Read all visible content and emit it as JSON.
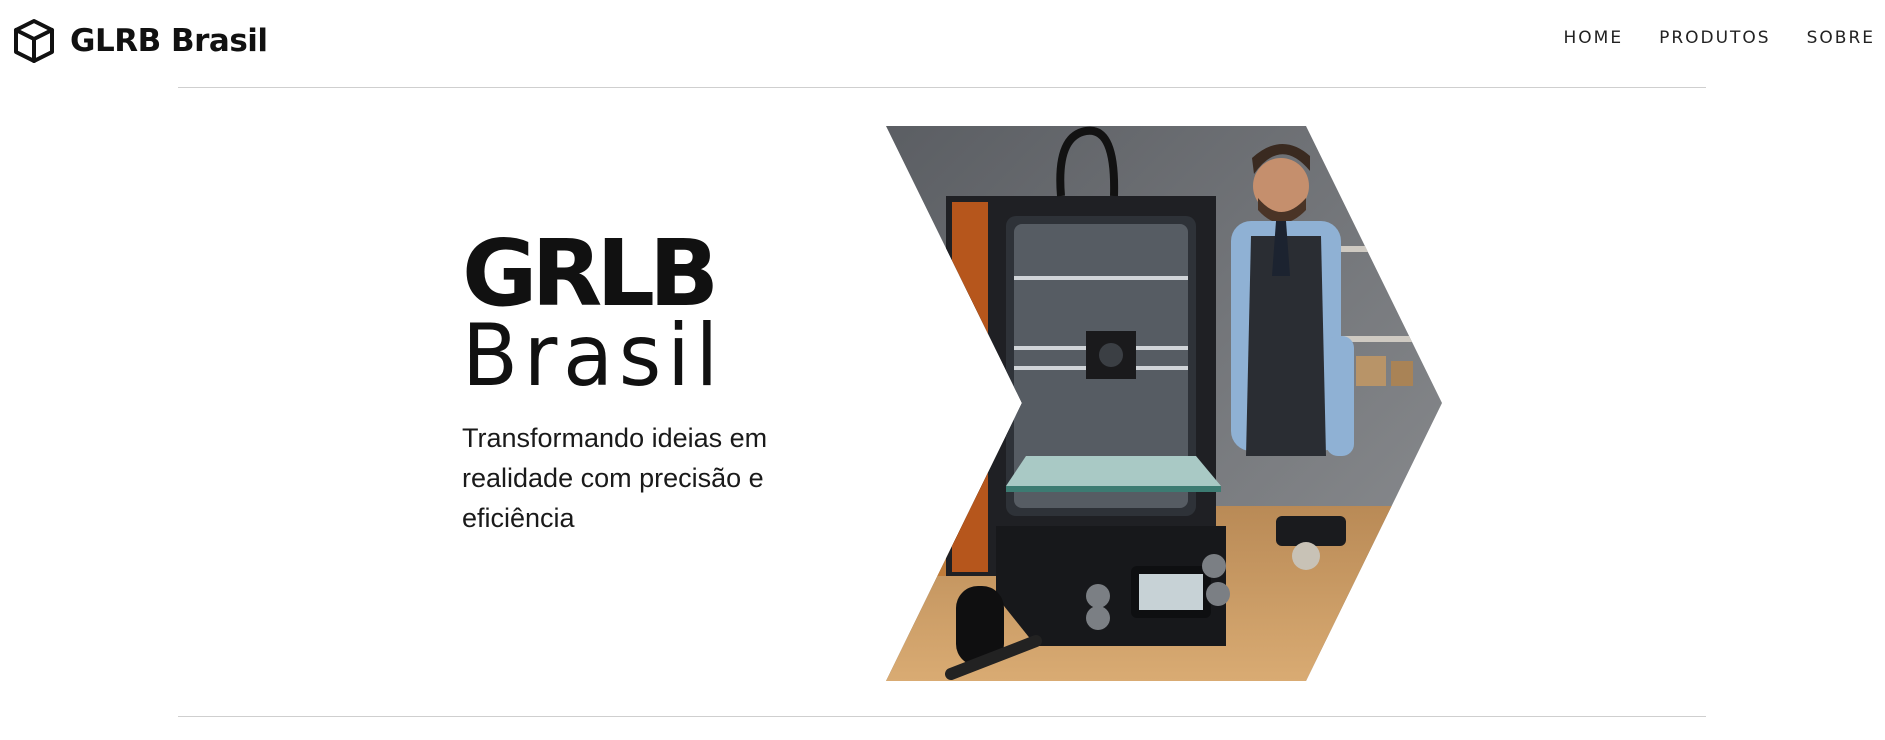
{
  "header": {
    "logo_icon": "cube-icon",
    "brand_name": "GLRB Brasil",
    "nav": [
      {
        "label": "HOME"
      },
      {
        "label": "PRODUTOS"
      },
      {
        "label": "SOBRE"
      }
    ]
  },
  "hero": {
    "title_bold": "GRLB",
    "title_light": "Brasil",
    "subtitle": "Transformando ideias em realidade com precisão e eficiência"
  },
  "colors": {
    "text": "#111111",
    "divider": "#cfcfcf",
    "background": "#ffffff"
  }
}
